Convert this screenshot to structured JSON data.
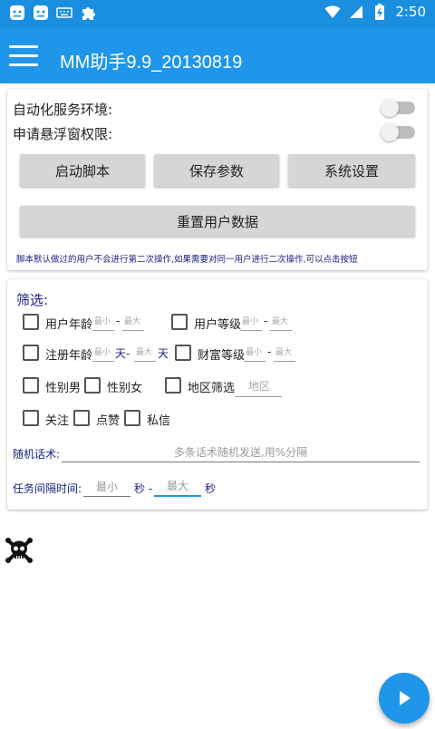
{
  "statusbar": {
    "left_icons": [
      "android-face-icon",
      "android-face-icon",
      "keyboard-icon",
      "puzzle-icon"
    ],
    "time": "2:50"
  },
  "appbar": {
    "title": "MM助手9.9_20130819"
  },
  "settings": {
    "auto_service_label": "自动化服务环境:",
    "overlay_permission_label": "申请悬浮窗权限:",
    "auto_service_enabled": false,
    "overlay_permission_enabled": false
  },
  "buttons": {
    "start_script": "启动脚本",
    "save_params": "保存参数",
    "system_settings": "系统设置",
    "reset_user_data": "重置用户数据"
  },
  "note": "脚本默认做过的用户不会进行第二次操作,如果需要对同一用户进行二次操作,可以点击按钮",
  "filter": {
    "title": "筛选:",
    "user_age": "用户年龄",
    "user_level": "用户等级",
    "register_age": "注册年龄",
    "wealth_level": "财富等级",
    "gender_male": "性别男",
    "gender_female": "性别女",
    "region_filter": "地区筛选",
    "follow": "关注",
    "like": "点赞",
    "private_message": "私信",
    "min_placeholder": "最小",
    "max_placeholder": "最大",
    "region_placeholder": "地区",
    "dash": "-",
    "day_dash": "天-",
    "day": "天"
  },
  "random_speech": {
    "label": "随机话术:",
    "placeholder": "多条话术随机发送,用%分隔"
  },
  "interval": {
    "label": "任务间隔时间:",
    "min_placeholder": "最小",
    "max_placeholder": "最大",
    "sec_dash": "秒 -",
    "sec": "秒"
  },
  "colors": {
    "primary": "#1f96ea",
    "statusbar": "#1a8fe0",
    "label_blue": "#1a237e"
  }
}
